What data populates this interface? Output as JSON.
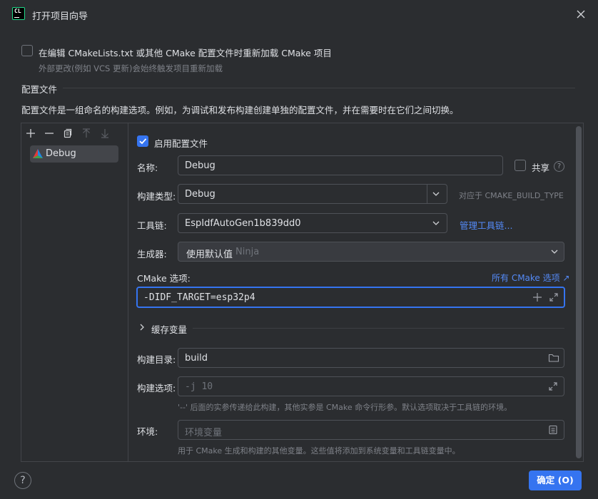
{
  "window": {
    "title": "打开项目向导",
    "logo_text": "CL",
    "logo_icon": "clion-logo-icon"
  },
  "reload": {
    "checkbox_label": "在编辑 CMakeLists.txt 或其他 CMake 配置文件时重新加载 CMake 项目",
    "checked": false,
    "hint": "外部更改(例如 VCS 更新)会始终触发项目重新加载"
  },
  "profiles_section": {
    "title": "配置文件",
    "description": "配置文件是一组命名的构建选项。例如，为调试和发布构建创建单独的配置文件，并在需要时在它们之间切换。"
  },
  "toolbar": {
    "icons": [
      "plus-icon",
      "minus-icon",
      "copy-icon",
      "arrow-up-icon",
      "arrow-down-icon"
    ]
  },
  "profiles": [
    {
      "label": "Debug",
      "icon": "cmake-triangle-icon",
      "selected": true
    }
  ],
  "form": {
    "enable_label": "启用配置文件",
    "enabled": true,
    "name_label": "名称:",
    "name_value": "Debug",
    "share_label": "共享",
    "share_checked": false,
    "build_type_label": "构建类型:",
    "build_type_value": "Debug",
    "build_type_hint": "对应于 CMAKE_BUILD_TYPE",
    "toolchain_label": "工具链:",
    "toolchain_value": "EspIdfAutoGen1b839dd0",
    "toolchain_link": "管理工具链...",
    "generator_label": "生成器:",
    "generator_value": "使用默认值",
    "generator_hint": "Ninja",
    "cmake_options_label": "CMake 选项:",
    "cmake_options_link": "所有 CMake 选项 ↗",
    "cmake_options_value": "-DIDF_TARGET=esp32p4",
    "cache_vars_label": "缓存变量",
    "build_dir_label": "构建目录:",
    "build_dir_value": "build",
    "build_options_label": "构建选项:",
    "build_options_placeholder": "-j 10",
    "build_options_hint": "'--' 后面的实参传递给此构建，其他实参是 CMake 命令行形参。默认选项取决于工具链的环境。",
    "env_label": "环境:",
    "env_placeholder": "环境变量",
    "env_hint": "用于 CMake 生成和构建的其他变量。这些值将添加到系统变量和工具链变量中。"
  },
  "footer": {
    "help_label": "?",
    "ok_label": "确定 (O)"
  },
  "colors": {
    "accent": "#3574f0",
    "background": "#2b2d30",
    "link": "#548af7"
  }
}
